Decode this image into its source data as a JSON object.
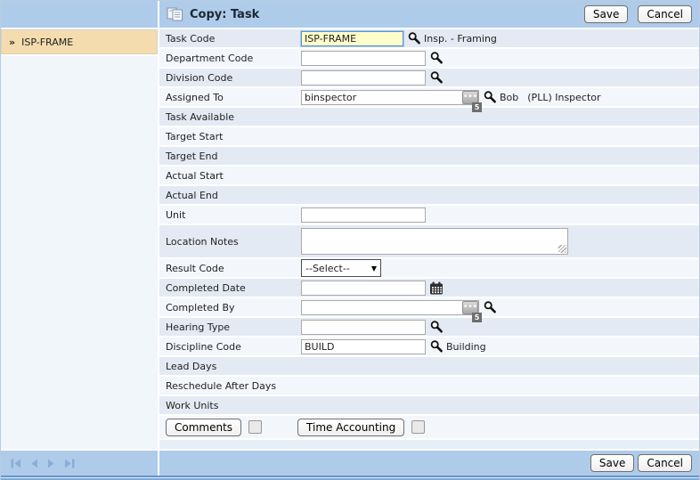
{
  "header": {
    "title": "Copy: Task",
    "save": "Save",
    "cancel": "Cancel"
  },
  "sidebar": {
    "item": {
      "marker": "»",
      "label": "ISP-FRAME"
    }
  },
  "form": {
    "task_code": {
      "label": "Task Code",
      "value": "ISP-FRAME",
      "helper": "Insp. - Framing"
    },
    "department_code": {
      "label": "Department Code",
      "value": ""
    },
    "division_code": {
      "label": "Division Code",
      "value": ""
    },
    "assigned_to": {
      "label": "Assigned To",
      "value": "binspector",
      "badge": "5",
      "helper_name": "Bob",
      "helper_detail": "(PLL) Inspector"
    },
    "task_available": {
      "label": "Task Available"
    },
    "target_start": {
      "label": "Target Start"
    },
    "target_end": {
      "label": "Target End"
    },
    "actual_start": {
      "label": "Actual Start"
    },
    "actual_end": {
      "label": "Actual End"
    },
    "unit": {
      "label": "Unit",
      "value": ""
    },
    "location_notes": {
      "label": "Location Notes",
      "value": ""
    },
    "result_code": {
      "label": "Result Code",
      "value": "--Select--"
    },
    "completed_date": {
      "label": "Completed Date",
      "value": ""
    },
    "completed_by": {
      "label": "Completed By",
      "value": "",
      "badge": "5"
    },
    "hearing_type": {
      "label": "Hearing Type",
      "value": ""
    },
    "discipline_code": {
      "label": "Discipline Code",
      "value": "BUILD",
      "helper": "Building"
    },
    "lead_days": {
      "label": "Lead Days"
    },
    "reschedule_after_days": {
      "label": "Reschedule After Days"
    },
    "work_units": {
      "label": "Work Units"
    },
    "buttons": {
      "comments": "Comments",
      "time_accounting": "Time Accounting"
    }
  },
  "footer": {
    "save": "Save",
    "cancel": "Cancel"
  },
  "colors": {
    "bar": "#aecbe9",
    "row_dark": "#e4eaf3",
    "row_light": "#f3f6fb",
    "selected_item": "#f4dcae",
    "focus_bg": "#ffffcc"
  }
}
